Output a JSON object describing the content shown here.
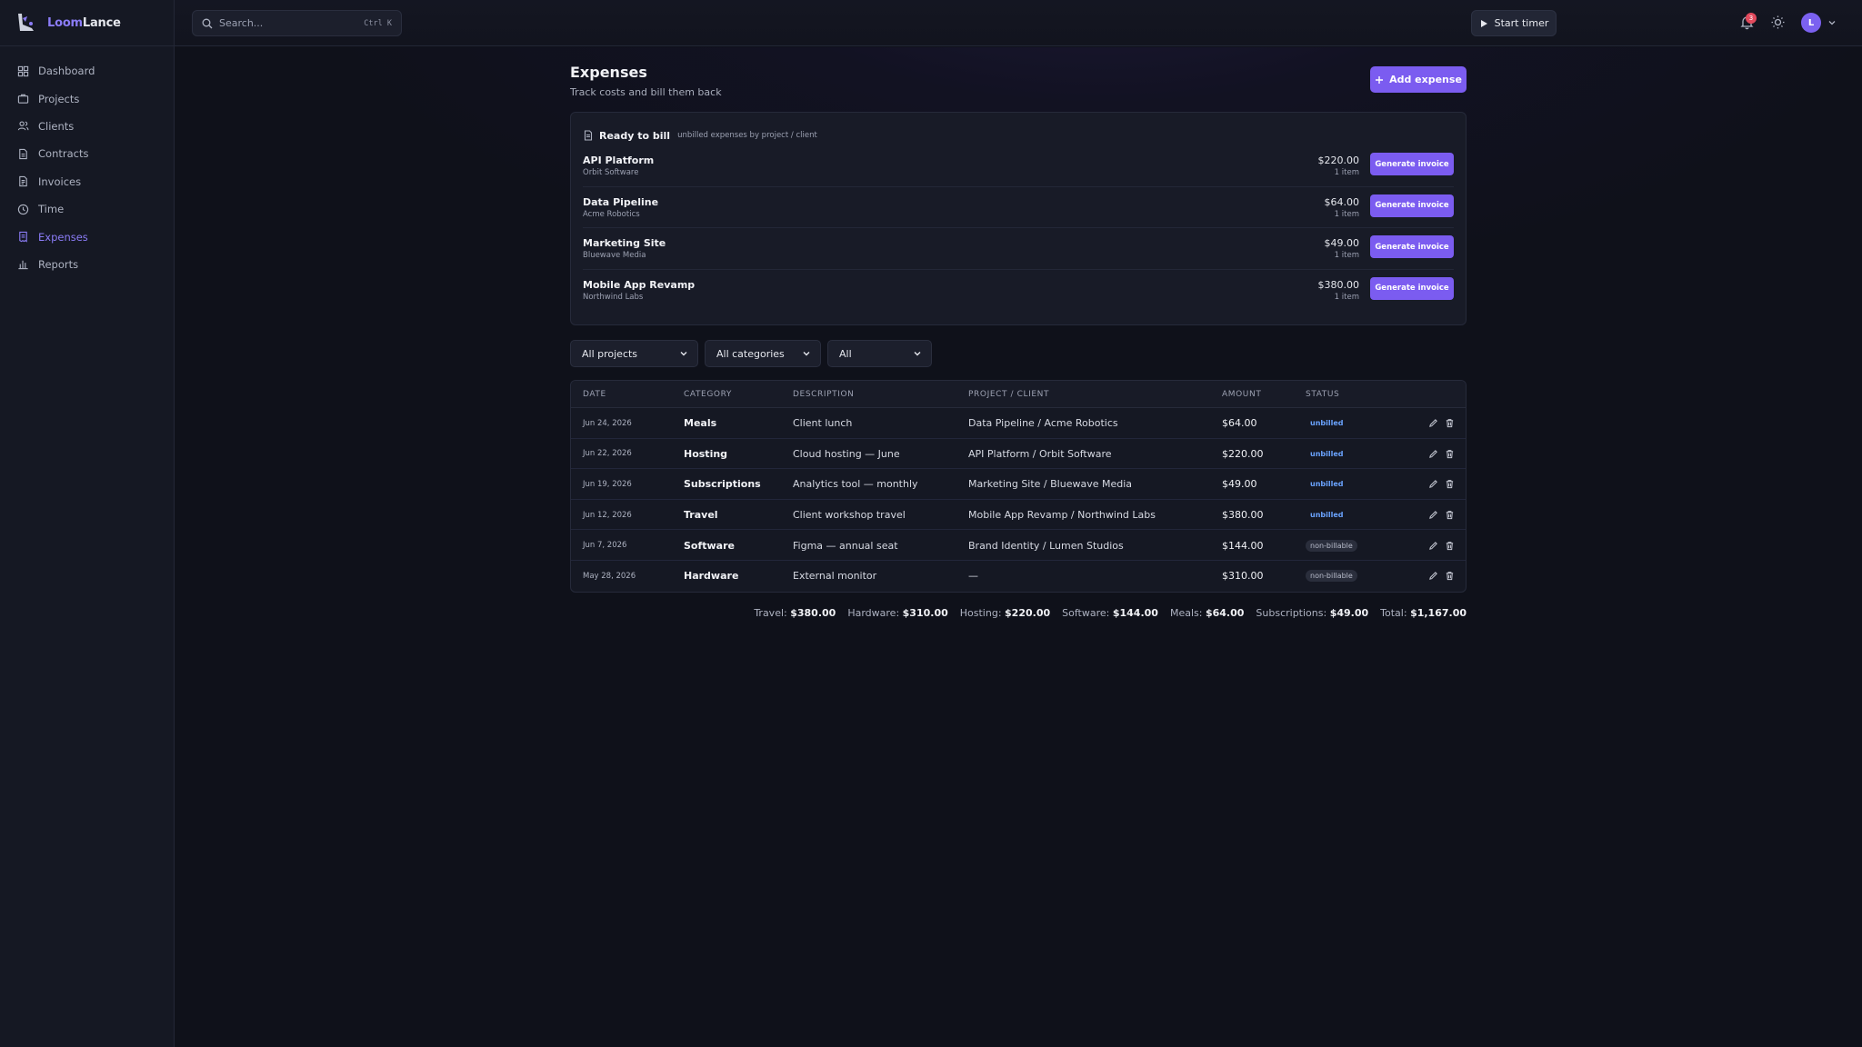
{
  "brand": {
    "name_prefix": "Loom",
    "name_suffix": "Lance",
    "accent": "#8b7cf6"
  },
  "sidebar": {
    "items": [
      {
        "label": "Dashboard",
        "icon": "dashboard-icon"
      },
      {
        "label": "Projects",
        "icon": "briefcase-icon"
      },
      {
        "label": "Clients",
        "icon": "users-icon"
      },
      {
        "label": "Contracts",
        "icon": "document-icon"
      },
      {
        "label": "Invoices",
        "icon": "invoice-icon"
      },
      {
        "label": "Time",
        "icon": "clock-icon"
      },
      {
        "label": "Expenses",
        "icon": "receipt-icon",
        "active": true
      },
      {
        "label": "Reports",
        "icon": "bar-chart-icon"
      }
    ]
  },
  "topbar": {
    "search_placeholder": "Search...",
    "search_shortcut": "Ctrl K",
    "timer_label": "Start timer",
    "notification_count": "3",
    "avatar_initial": "L"
  },
  "page": {
    "title": "Expenses",
    "subtitle": "Track costs and bill them back",
    "add_label": "Add expense"
  },
  "ready_to_bill": {
    "title": "Ready to bill",
    "subtitle": "unbilled expenses by project / client",
    "button_label": "Generate invoice",
    "rows": [
      {
        "project": "API Platform",
        "client": "Orbit Software",
        "amount": "$220.00",
        "items": "1 item"
      },
      {
        "project": "Data Pipeline",
        "client": "Acme Robotics",
        "amount": "$64.00",
        "items": "1 item"
      },
      {
        "project": "Marketing Site",
        "client": "Bluewave Media",
        "amount": "$49.00",
        "items": "1 item"
      },
      {
        "project": "Mobile App Revamp",
        "client": "Northwind Labs",
        "amount": "$380.00",
        "items": "1 item"
      }
    ]
  },
  "filters": {
    "project": "All projects",
    "category": "All categories",
    "status": "All"
  },
  "table": {
    "headers": {
      "date": "DATE",
      "category": "CATEGORY",
      "description": "DESCRIPTION",
      "project": "PROJECT / CLIENT",
      "amount": "AMOUNT",
      "status": "STATUS"
    },
    "rows": [
      {
        "date": "Jun 24, 2026",
        "category": "Meals",
        "description": "Client lunch",
        "project": "Data Pipeline / Acme Robotics",
        "amount": "$64.00",
        "status": "unbilled"
      },
      {
        "date": "Jun 22, 2026",
        "category": "Hosting",
        "description": "Cloud hosting — June",
        "project": "API Platform / Orbit Software",
        "amount": "$220.00",
        "status": "unbilled"
      },
      {
        "date": "Jun 19, 2026",
        "category": "Subscriptions",
        "description": "Analytics tool — monthly",
        "project": "Marketing Site / Bluewave Media",
        "amount": "$49.00",
        "status": "unbilled"
      },
      {
        "date": "Jun 12, 2026",
        "category": "Travel",
        "description": "Client workshop travel",
        "project": "Mobile App Revamp / Northwind Labs",
        "amount": "$380.00",
        "status": "unbilled"
      },
      {
        "date": "Jun 7, 2026",
        "category": "Software",
        "description": "Figma — annual seat",
        "project": "Brand Identity / Lumen Studios",
        "amount": "$144.00",
        "status": "non-billable"
      },
      {
        "date": "May 28, 2026",
        "category": "Hardware",
        "description": "External monitor",
        "project": "—",
        "amount": "$310.00",
        "status": "non-billable"
      }
    ]
  },
  "totals": [
    {
      "label": "Travel:",
      "value": "$380.00"
    },
    {
      "label": "Hardware:",
      "value": "$310.00"
    },
    {
      "label": "Hosting:",
      "value": "$220.00"
    },
    {
      "label": "Software:",
      "value": "$144.00"
    },
    {
      "label": "Meals:",
      "value": "$64.00"
    },
    {
      "label": "Subscriptions:",
      "value": "$49.00"
    },
    {
      "label": "Total:",
      "value": "$1,167.00"
    }
  ]
}
